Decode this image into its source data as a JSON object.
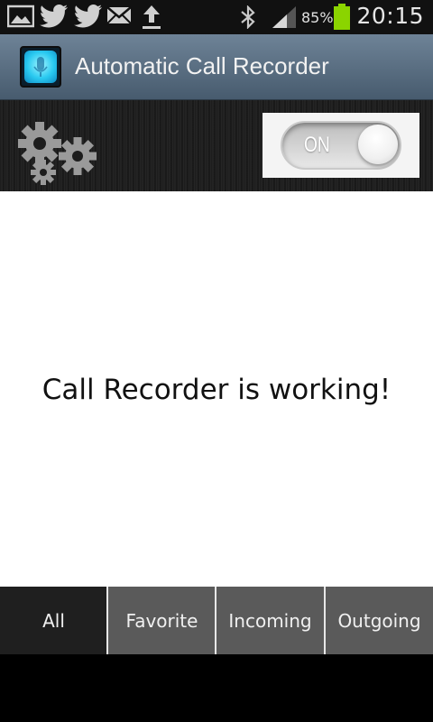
{
  "status_bar": {
    "battery_percent": "85%",
    "clock": "20:15",
    "icons": [
      "gallery-icon",
      "twitter-icon",
      "twitter-icon",
      "mail-icon",
      "upload-icon",
      "bluetooth-icon",
      "signal-icon",
      "battery-icon"
    ]
  },
  "app": {
    "title": "Automatic Call Recorder",
    "icon": "app-icon"
  },
  "control": {
    "settings_icon": "gears-icon",
    "toggle_label": "ON",
    "toggle_state": "on"
  },
  "main": {
    "message": "Call Recorder is working!"
  },
  "tabs": [
    {
      "label": "All",
      "active": true
    },
    {
      "label": "Favorite",
      "active": false
    },
    {
      "label": "Incoming",
      "active": false
    },
    {
      "label": "Outgoing",
      "active": false
    }
  ],
  "colors": {
    "title_bar": "#5c7185",
    "tab_active": "#1f1f1f",
    "tab_inactive": "#5a5a5a",
    "battery": "#8bd400"
  }
}
